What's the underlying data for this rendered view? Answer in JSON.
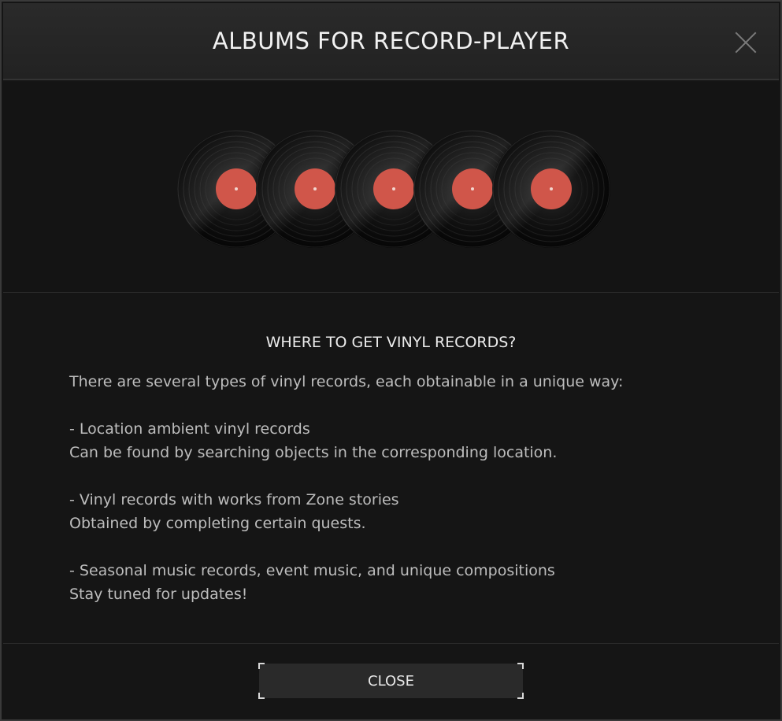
{
  "dialog": {
    "title": "ALBUMS FOR RECORD-PLAYER",
    "close_icon": "close-icon"
  },
  "records": {
    "count": 5,
    "label_color": "#d0564a",
    "disc_color": "#0e0e0e"
  },
  "info": {
    "heading": "WHERE TO GET VINYL RECORDS?",
    "intro": "There are several types of vinyl records, each obtainable in a unique way:",
    "items": [
      {
        "title": "- Location ambient vinyl records",
        "desc": "Can be found by searching objects in the corresponding location."
      },
      {
        "title": "- Vinyl records with works from Zone stories",
        "desc": "Obtained by completing certain quests."
      },
      {
        "title": "- Seasonal music records, event music, and unique compositions",
        "desc": "Stay tuned for updates!"
      }
    ]
  },
  "footer": {
    "close_label": "CLOSE"
  }
}
